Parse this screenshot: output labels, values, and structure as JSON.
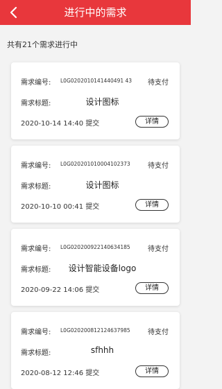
{
  "header": {
    "title": "进行中的需求"
  },
  "summary": {
    "count_text": "共有21个需求进行中"
  },
  "labels": {
    "number": "需求编号:",
    "title": "需求标题:",
    "submitted": "提交",
    "details": "详情"
  },
  "orders": [
    {
      "number": "L0G0202010141440491 43",
      "title": "设计图标",
      "status": "待支付",
      "date": "2020-10-14 14:40"
    },
    {
      "number": "L0G020201010004102373",
      "title": "设计图标",
      "status": "待支付",
      "date": "2020-10-10 00:41"
    },
    {
      "number": "L0G020200922140634185",
      "title": "设计智能设备logo",
      "status": "待支付",
      "date": "2020-09-22 14:06"
    },
    {
      "number": "L0G020200812124637985",
      "title": "sfhhh",
      "status": "待支付",
      "date": "2020-08-12 12:46"
    }
  ],
  "colors": {
    "header_bg": "#e8373c",
    "page_bg": "#f3f3f3"
  }
}
